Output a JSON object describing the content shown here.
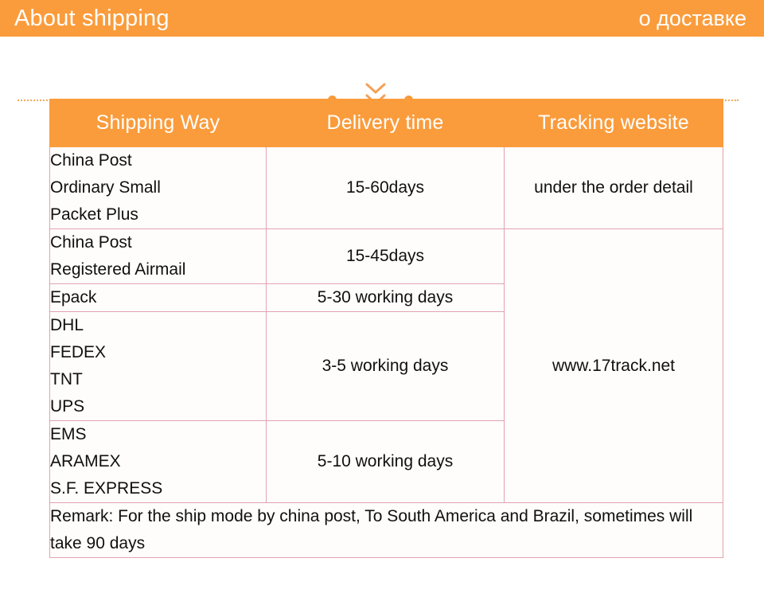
{
  "header": {
    "title_en": "About shipping",
    "title_ru": "о доставке",
    "bar_color": "#fa9c3c",
    "text_color": "#ffffff"
  },
  "divider": {
    "chevron_icon": "chevron-down-icon",
    "chevron_count": 3,
    "line_color": "#f0a958",
    "dot_color": "#f79a3a"
  },
  "table": {
    "border_color": "#e2a3b1",
    "header_bg": "#fa9c3c",
    "columns": [
      "Shipping Way",
      "Delivery time",
      "Tracking website"
    ],
    "rows": [
      {
        "way_lines": [
          "China Post",
          "Ordinary Small",
          "Packet Plus"
        ],
        "delivery_time": "15-60days",
        "tracking": "under the order detail"
      },
      {
        "way_lines": [
          "China Post",
          "Registered Airmail"
        ],
        "delivery_time": "15-45days",
        "tracking": ""
      },
      {
        "way_lines": [
          "Epack"
        ],
        "delivery_time": "5-30 working days",
        "tracking": ""
      },
      {
        "way_lines": [
          "DHL",
          "FEDEX",
          "TNT",
          "UPS"
        ],
        "delivery_time": "3-5 working days",
        "tracking": "www.17track.net"
      },
      {
        "way_lines": [
          "EMS",
          "ARAMEX",
          "S.F. EXPRESS"
        ],
        "delivery_time": "5-10 working days",
        "tracking": ""
      }
    ],
    "remark": "Remark: For the ship mode by china post, To South America and Brazil, sometimes will take 90 days"
  }
}
